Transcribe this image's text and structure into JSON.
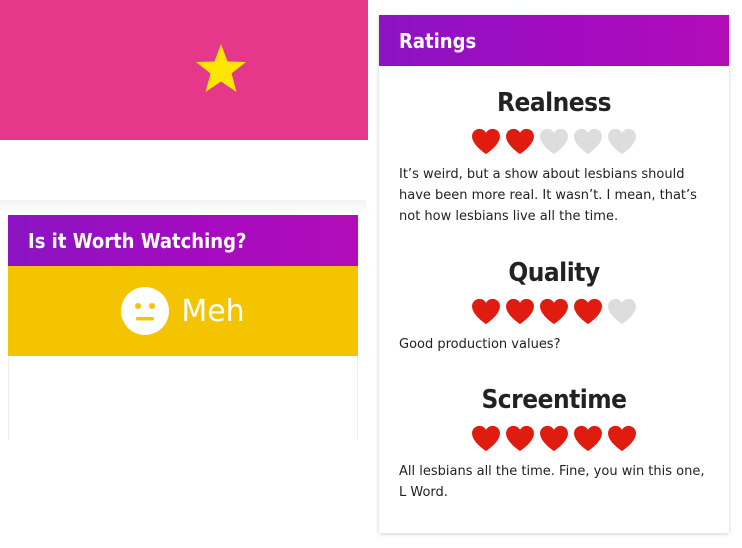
{
  "hero": {
    "background": "#e5388b",
    "icon": "star-icon",
    "icon_color": "#ffe600"
  },
  "worth": {
    "title": "Is it Worth Watching?",
    "verdict": "Meh",
    "verdict_icon": "neutral-face-icon",
    "verdict_color": "#f5c400"
  },
  "ratings": {
    "title": "Ratings",
    "heart_filled_color": "#e01b10",
    "heart_empty_color": "#dddddd",
    "items": [
      {
        "name": "Realness",
        "score": 2,
        "max": 5,
        "description": "It’s weird, but a show about lesbians should have been more real. It wasn’t. I mean, that’s not how lesbians live all the time."
      },
      {
        "name": "Quality",
        "score": 4,
        "max": 5,
        "description": "Good production values?"
      },
      {
        "name": "Screentime",
        "score": 5,
        "max": 5,
        "description": "All lesbians all the time. Fine, you win this one, L Word."
      }
    ]
  }
}
